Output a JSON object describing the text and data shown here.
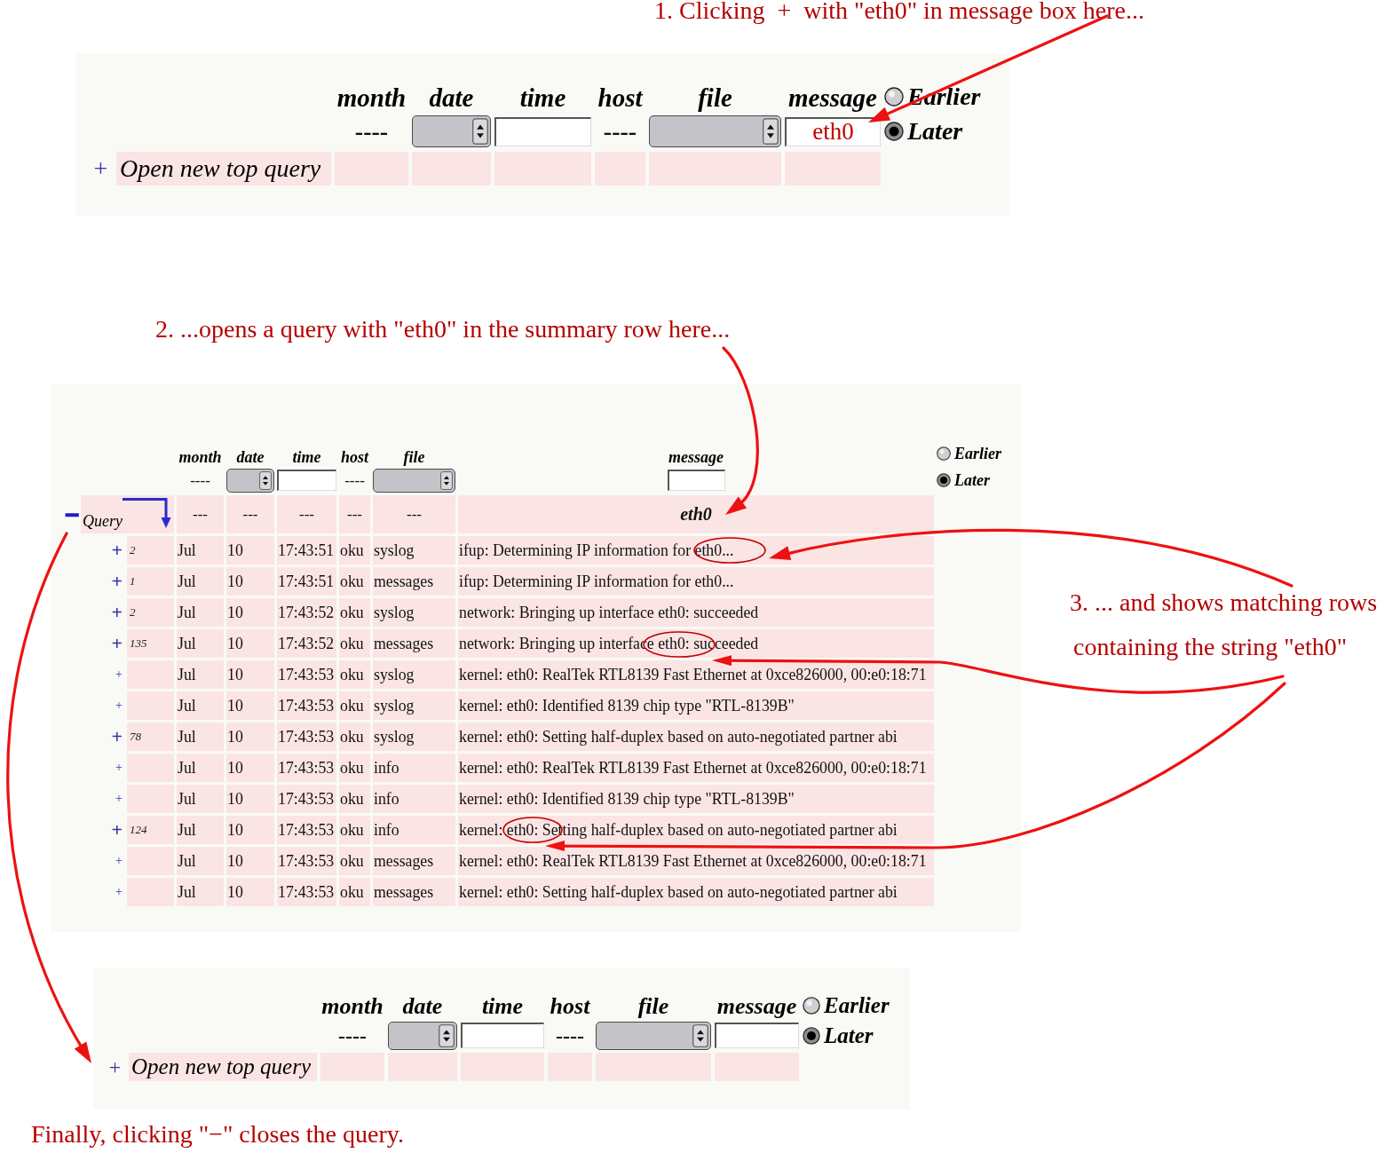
{
  "step_1_caption": "1. Clicking  +  with \"eth0\" in message box here...",
  "top_form": {
    "columns": [
      "month",
      "date",
      "time",
      "host",
      "file",
      "message"
    ],
    "month_value": "----",
    "host_value": "----",
    "message_value": "eth0",
    "order_options": [
      {
        "label": "Earlier",
        "selected": false
      },
      {
        "label": "Later",
        "selected": true
      }
    ],
    "open_button": "+",
    "open_label": "Open new top query"
  },
  "step_2_caption": "2. ...opens a query with \"eth0\" in the summary row here...",
  "query_panel": {
    "columns": [
      "month",
      "date",
      "time",
      "host",
      "file",
      "message"
    ],
    "month_value": "----",
    "host_value": "----",
    "order_options": [
      {
        "label": "Earlier",
        "selected": false
      },
      {
        "label": "Later",
        "selected": true
      }
    ],
    "summary": {
      "collapse_button": "−",
      "label": "Query",
      "cells": [
        "---",
        "---",
        "---",
        "---",
        "---",
        "eth0"
      ]
    },
    "rows": [
      {
        "kind": "group",
        "expand": "+",
        "count": "2",
        "month": "Jul",
        "date": "10",
        "time": "17:43:51",
        "host": "oku",
        "file": "syslog",
        "message": "ifup: Determining IP information for eth0..."
      },
      {
        "kind": "group",
        "expand": "+",
        "count": "1",
        "month": "Jul",
        "date": "10",
        "time": "17:43:51",
        "host": "oku",
        "file": "messages",
        "message": "ifup: Determining IP information for eth0..."
      },
      {
        "kind": "group",
        "expand": "+",
        "count": "2",
        "month": "Jul",
        "date": "10",
        "time": "17:43:52",
        "host": "oku",
        "file": "syslog",
        "message": "network: Bringing up interface eth0: succeeded"
      },
      {
        "kind": "group",
        "expand": "+",
        "count": "135",
        "month": "Jul",
        "date": "10",
        "time": "17:43:52",
        "host": "oku",
        "file": "messages",
        "message": "network: Bringing up interface eth0: succeeded"
      },
      {
        "kind": "single",
        "expand": "+",
        "month": "Jul",
        "date": "10",
        "time": "17:43:53",
        "host": "oku",
        "file": "syslog",
        "message": "kernel: eth0: RealTek RTL8139 Fast Ethernet at 0xce826000, 00:e0:18:71"
      },
      {
        "kind": "single",
        "expand": "+",
        "month": "Jul",
        "date": "10",
        "time": "17:43:53",
        "host": "oku",
        "file": "syslog",
        "message": "kernel: eth0: Identified 8139 chip type \"RTL-8139B\""
      },
      {
        "kind": "group",
        "expand": "+",
        "count": "78",
        "month": "Jul",
        "date": "10",
        "time": "17:43:53",
        "host": "oku",
        "file": "syslog",
        "message": "kernel: eth0: Setting half-duplex based on auto-negotiated partner abi"
      },
      {
        "kind": "single",
        "expand": "+",
        "month": "Jul",
        "date": "10",
        "time": "17:43:53",
        "host": "oku",
        "file": "info",
        "message": "kernel: eth0: RealTek RTL8139 Fast Ethernet at 0xce826000, 00:e0:18:71"
      },
      {
        "kind": "single",
        "expand": "+",
        "month": "Jul",
        "date": "10",
        "time": "17:43:53",
        "host": "oku",
        "file": "info",
        "message": "kernel: eth0: Identified 8139 chip type \"RTL-8139B\""
      },
      {
        "kind": "group",
        "expand": "+",
        "count": "124",
        "month": "Jul",
        "date": "10",
        "time": "17:43:53",
        "host": "oku",
        "file": "info",
        "message": "kernel: eth0: Setting half-duplex based on auto-negotiated partner abi"
      },
      {
        "kind": "single",
        "expand": "+",
        "month": "Jul",
        "date": "10",
        "time": "17:43:53",
        "host": "oku",
        "file": "messages",
        "message": "kernel: eth0: RealTek RTL8139 Fast Ethernet at 0xce826000, 00:e0:18:71"
      },
      {
        "kind": "single",
        "expand": "+",
        "month": "Jul",
        "date": "10",
        "time": "17:43:53",
        "host": "oku",
        "file": "messages",
        "message": "kernel: eth0: Setting half-duplex based on auto-negotiated partner abi"
      }
    ]
  },
  "step_3_caption": [
    "3. ... and shows matching rows",
    "containing the string \"eth0\""
  ],
  "bottom_form": {
    "columns": [
      "month",
      "date",
      "time",
      "host",
      "file",
      "message"
    ],
    "month_value": "----",
    "host_value": "----",
    "order_options": [
      {
        "label": "Earlier",
        "selected": false
      },
      {
        "label": "Later",
        "selected": true
      }
    ],
    "open_button": "+",
    "open_label": "Open new top query"
  },
  "final_caption": "Finally, clicking \"−\" closes the query."
}
